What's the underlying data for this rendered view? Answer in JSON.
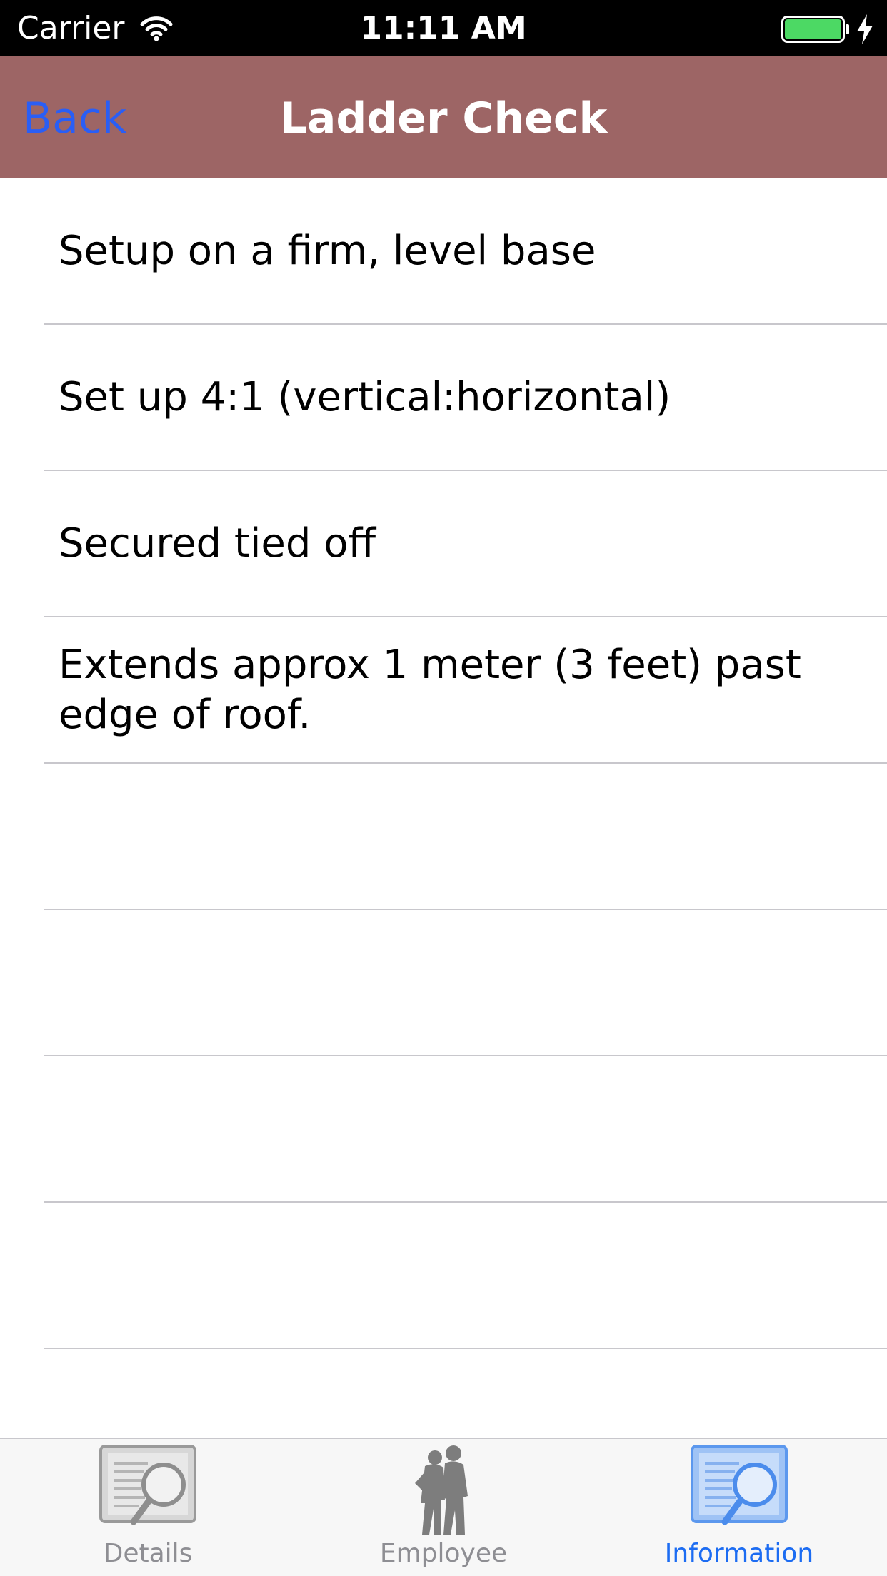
{
  "status_bar": {
    "carrier": "Carrier",
    "time": "11:11 AM"
  },
  "nav": {
    "back_label": "Back",
    "title": "Ladder Check"
  },
  "checklist": {
    "items": [
      {
        "text": "Setup on a firm, level base"
      },
      {
        "text": "Set up 4:1 (vertical:horizontal)"
      },
      {
        "text": "Secured tied off"
      },
      {
        "text": "Extends approx 1 meter (3 feet) past edge of roof."
      },
      {
        "text": ""
      },
      {
        "text": ""
      },
      {
        "text": ""
      },
      {
        "text": ""
      }
    ]
  },
  "tabs": [
    {
      "label": "Details",
      "icon": "document-search-icon",
      "active": false
    },
    {
      "label": "Employee",
      "icon": "workers-silhouette-icon",
      "active": false
    },
    {
      "label": "Information",
      "icon": "document-search-icon",
      "active": true
    }
  ],
  "colors": {
    "nav_background": "#9d6565",
    "back_button": "#2a5ef5",
    "active_tab": "#1c6cf2",
    "inactive_tab": "#8e8e93",
    "battery_fill": "#4cd964"
  }
}
